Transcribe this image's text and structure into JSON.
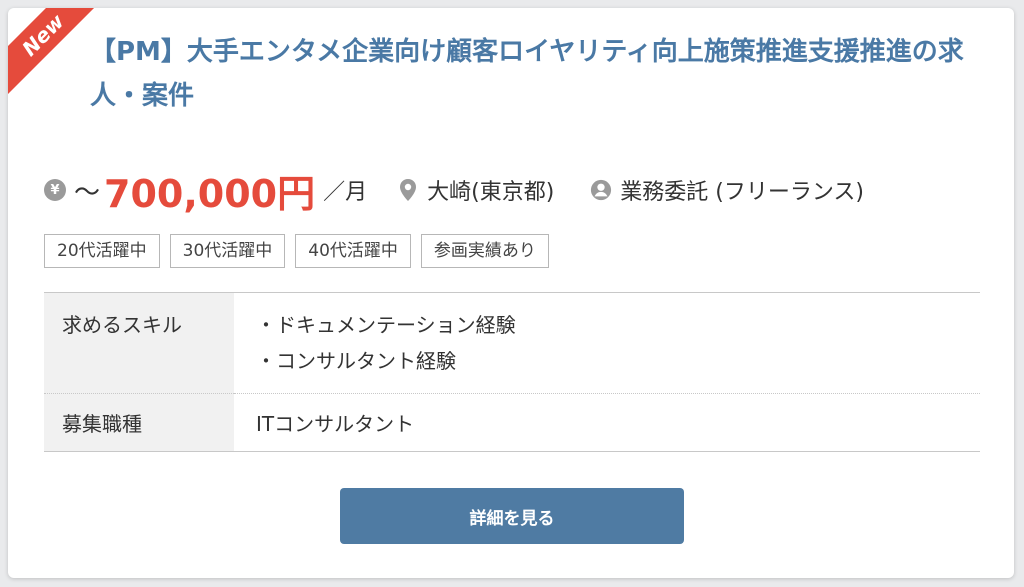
{
  "badge": "New",
  "title": "【PM】大手エンタメ企業向け顧客ロイヤリティ向上施策推進支援推進の求人・案件",
  "salary": {
    "currency_icon": "yen-icon",
    "prefix": "～",
    "amount": "700,000円",
    "unit": "／月"
  },
  "location": {
    "icon": "location-pin-icon",
    "text": "大崎(東京都)"
  },
  "contract": {
    "icon": "person-icon",
    "text": "業務委託 (フリーランス)"
  },
  "tags": [
    "20代活躍中",
    "30代活躍中",
    "40代活躍中",
    "参画実績あり"
  ],
  "details": {
    "skills_label": "求めるスキル",
    "skills": [
      "・ドキュメンテーション経験",
      "・コンサルタント経験"
    ],
    "position_label": "募集職種",
    "position": "ITコンサルタント"
  },
  "button": "詳細を見る",
  "colors": {
    "accent": "#4f7ba3",
    "title": "#4a79a5",
    "salary": "#e54b3c",
    "badge": "#e54b3c"
  }
}
